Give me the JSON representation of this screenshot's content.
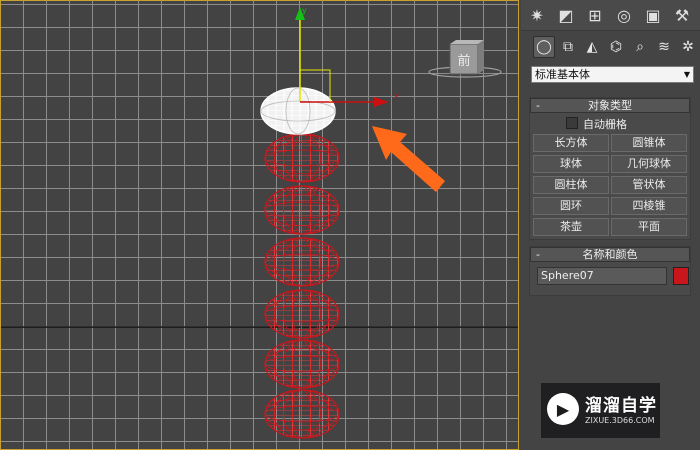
{
  "viewport": {
    "cube_label": "前",
    "object_color": "#c8161c",
    "selected_color": "#ffffff",
    "highlight_arrow_color": "#ff6a1a"
  },
  "panel": {
    "tabs": [
      {
        "icon": "create-icon"
      },
      {
        "icon": "modify-icon"
      },
      {
        "icon": "hierarchy-icon"
      },
      {
        "icon": "motion-icon"
      },
      {
        "icon": "display-icon"
      },
      {
        "icon": "utilities-icon"
      }
    ],
    "subtabs": [
      {
        "icon": "geometry-icon",
        "active": true
      },
      {
        "icon": "shapes-icon"
      },
      {
        "icon": "lights-icon"
      },
      {
        "icon": "cameras-icon"
      },
      {
        "icon": "helpers-icon"
      },
      {
        "icon": "spacewarps-icon"
      },
      {
        "icon": "systems-icon"
      }
    ],
    "category": "标准基本体",
    "object_type": {
      "title": "对象类型",
      "collapse": "-",
      "autogrid_label": "自动栅格",
      "autogrid_checked": false,
      "buttons": [
        "长方体",
        "圆锥体",
        "球体",
        "几何球体",
        "圆柱体",
        "管状体",
        "圆环",
        "四棱锥",
        "茶壶",
        "平面"
      ]
    },
    "name_color": {
      "title": "名称和颜色",
      "collapse": "-",
      "name": "Sphere07",
      "swatch_color": "#c8161c"
    }
  },
  "watermark": {
    "title": "溜溜自学",
    "url": "ZIXUE.3D66.COM"
  }
}
